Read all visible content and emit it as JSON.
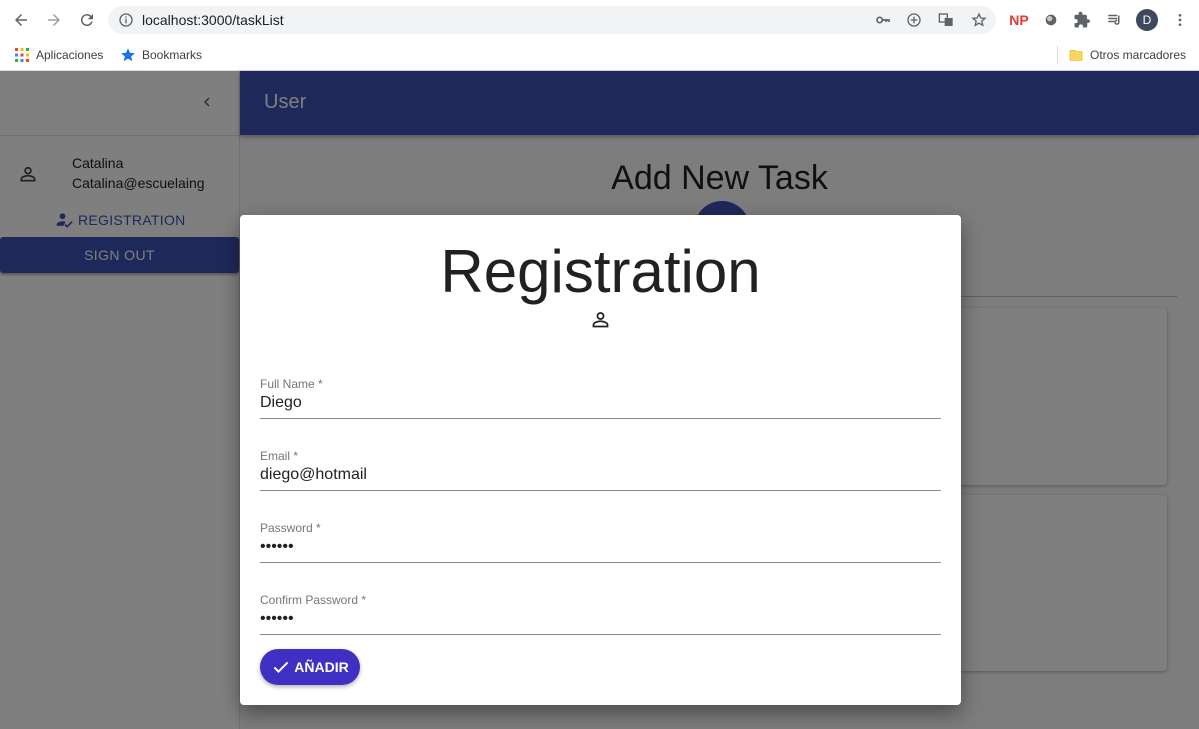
{
  "browser": {
    "url": "localhost:3000/taskList",
    "avatar_letter": "D",
    "np_label": "NP",
    "bookmarks": {
      "apps": "Aplicaciones",
      "bookmarks": "Bookmarks",
      "other": "Otros marcadores"
    }
  },
  "app": {
    "appbar_title": "User",
    "main_title": "Add New Task",
    "accent": "#3f51b5"
  },
  "drawer": {
    "user_name": "Catalina",
    "user_email": "Catalina@escuelaing",
    "registration_link": "REGISTRATION",
    "signout_label": "SIGN OUT"
  },
  "modal": {
    "title": "Registration",
    "fields": [
      {
        "label": "Full Name *",
        "value": "Diego"
      },
      {
        "label": "Email *",
        "value": "diego@hotmail"
      },
      {
        "label": "Password *",
        "value": "••••••"
      },
      {
        "label": "Confirm Password *",
        "value": "••••••"
      }
    ],
    "submit_label": "AÑADIR",
    "submit_color": "#3f2fc2"
  }
}
